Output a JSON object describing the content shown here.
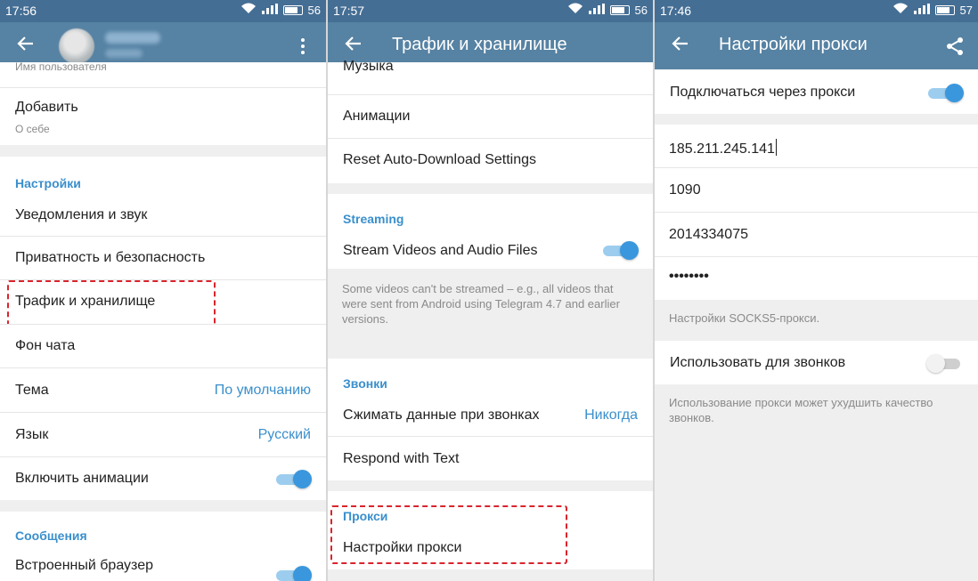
{
  "colors": {
    "status_bar": "#456e94",
    "app_bar": "#5682a3",
    "accent": "#3a8fcc",
    "highlight": "#d9242c"
  },
  "screens": [
    {
      "status": {
        "time": "17:56",
        "battery": "56"
      },
      "appbar": {
        "back_icon": "arrow-left-icon",
        "menu_icon": "more-vertical-icon"
      },
      "username_hint": "Имя пользователя",
      "bio": {
        "label": "Добавить",
        "sub": "О себе"
      },
      "settings_section": "Настройки",
      "items": [
        {
          "label": "Уведомления и звук"
        },
        {
          "label": "Приватность и безопасность"
        },
        {
          "label": "Трафик и хранилище"
        },
        {
          "label": "Фон чата"
        },
        {
          "label": "Тема",
          "value": "По умолчанию"
        },
        {
          "label": "Язык",
          "value": "Русский"
        },
        {
          "label": "Включить анимации",
          "toggle": true
        }
      ],
      "messages_section": "Сообщения",
      "browser_item": {
        "label": "Встроенный браузер",
        "toggle": true
      }
    },
    {
      "status": {
        "time": "17:57",
        "battery": "56"
      },
      "appbar": {
        "title": "Трафик и хранилище",
        "back_icon": "arrow-left-icon"
      },
      "media_items": [
        "Музыка",
        "Анимации",
        "Reset Auto-Download Settings"
      ],
      "streaming_section": "Streaming",
      "stream_item": {
        "label": "Stream Videos and Audio Files",
        "toggle": true
      },
      "stream_note": "Some videos can't be streamed – e.g., all videos that were sent from Android using Telegram 4.7 and earlier versions.",
      "calls_section": "Звонки",
      "compress": {
        "label": "Сжимать данные при звонках",
        "value": "Никогда"
      },
      "respond_item": "Respond with Text",
      "proxy_section": "Прокси",
      "proxy_item": "Настройки прокси"
    },
    {
      "status": {
        "time": "17:46",
        "battery": "57"
      },
      "appbar": {
        "title": "Настройки прокси",
        "back_icon": "arrow-left-icon",
        "share_icon": "share-icon"
      },
      "use_proxy": {
        "label": "Подключаться через прокси",
        "toggle": true
      },
      "fields": {
        "server": "185.211.245.141",
        "port": "1090",
        "username": "2014334075",
        "password": "••••••••"
      },
      "socks_note": "Настройки SOCKS5-прокси.",
      "calls": {
        "label": "Использовать для звонков",
        "toggle": false
      },
      "calls_note": "Использование прокси может ухудшить качество звонков."
    }
  ]
}
